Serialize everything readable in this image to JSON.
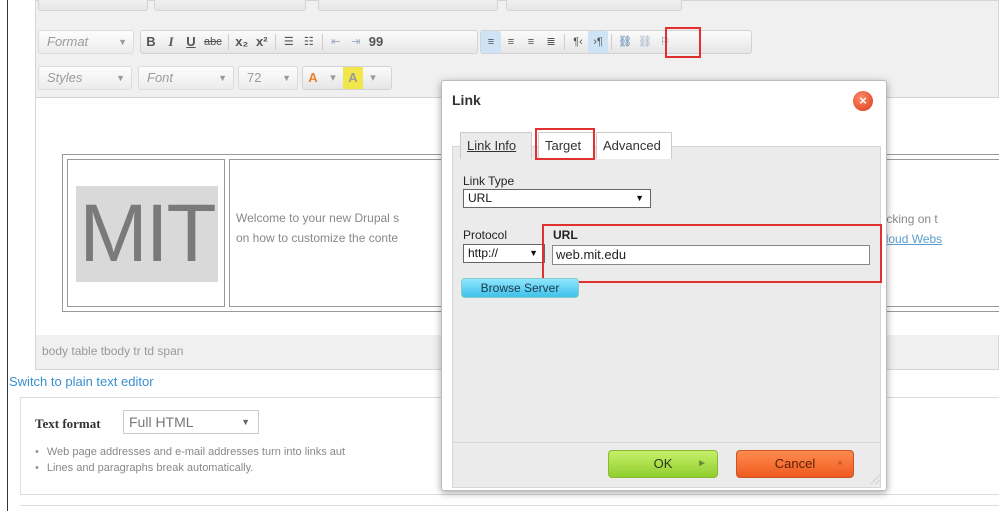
{
  "toolbar": {
    "row2": {
      "format_combo": "Format",
      "bold": "B",
      "italic": "I",
      "underline": "U",
      "strike": "abc",
      "subscript": "x₂",
      "superscript": "x²",
      "blockquote": "99",
      "rtl": "¶‹",
      "ltr": "›¶"
    },
    "row3": {
      "styles_combo": "Styles",
      "font_combo": "Font",
      "size_combo": "72",
      "text_color": "A",
      "bg_color": "A"
    }
  },
  "editor": {
    "logo_text": "MIT",
    "welcome_line1": "Welcome to your new Drupal s",
    "welcome_line2": "on how to customize the conte",
    "right_line1": "e by clicking on t",
    "right_line2": "upal Cloud Webs",
    "path": "body  table  tbody  tr  td  span"
  },
  "below_editor": {
    "switch_link": "Switch to plain text editor",
    "text_format_label": "Text format",
    "text_format_value": "Full HTML",
    "tips": [
      "Web page addresses and e-mail addresses turn into links aut",
      "Lines and paragraphs break automatically."
    ]
  },
  "dialog": {
    "title": "Link",
    "tabs": [
      {
        "label": "Link Info",
        "active": true
      },
      {
        "label": "Target",
        "active": false,
        "highlighted": true
      },
      {
        "label": "Advanced",
        "active": false
      }
    ],
    "link_type_label": "Link Type",
    "link_type_value": "URL",
    "protocol_label": "Protocol",
    "protocol_value": "http://",
    "url_label": "URL",
    "url_value": "web.mit.edu",
    "browse_button": "Browse Server",
    "ok_button": "OK",
    "cancel_button": "Cancel"
  },
  "colors": {
    "highlight": "#e03030",
    "link": "#3a8fd0",
    "ok_green": "#8fce2e",
    "cancel_orange": "#ef5a1f"
  }
}
